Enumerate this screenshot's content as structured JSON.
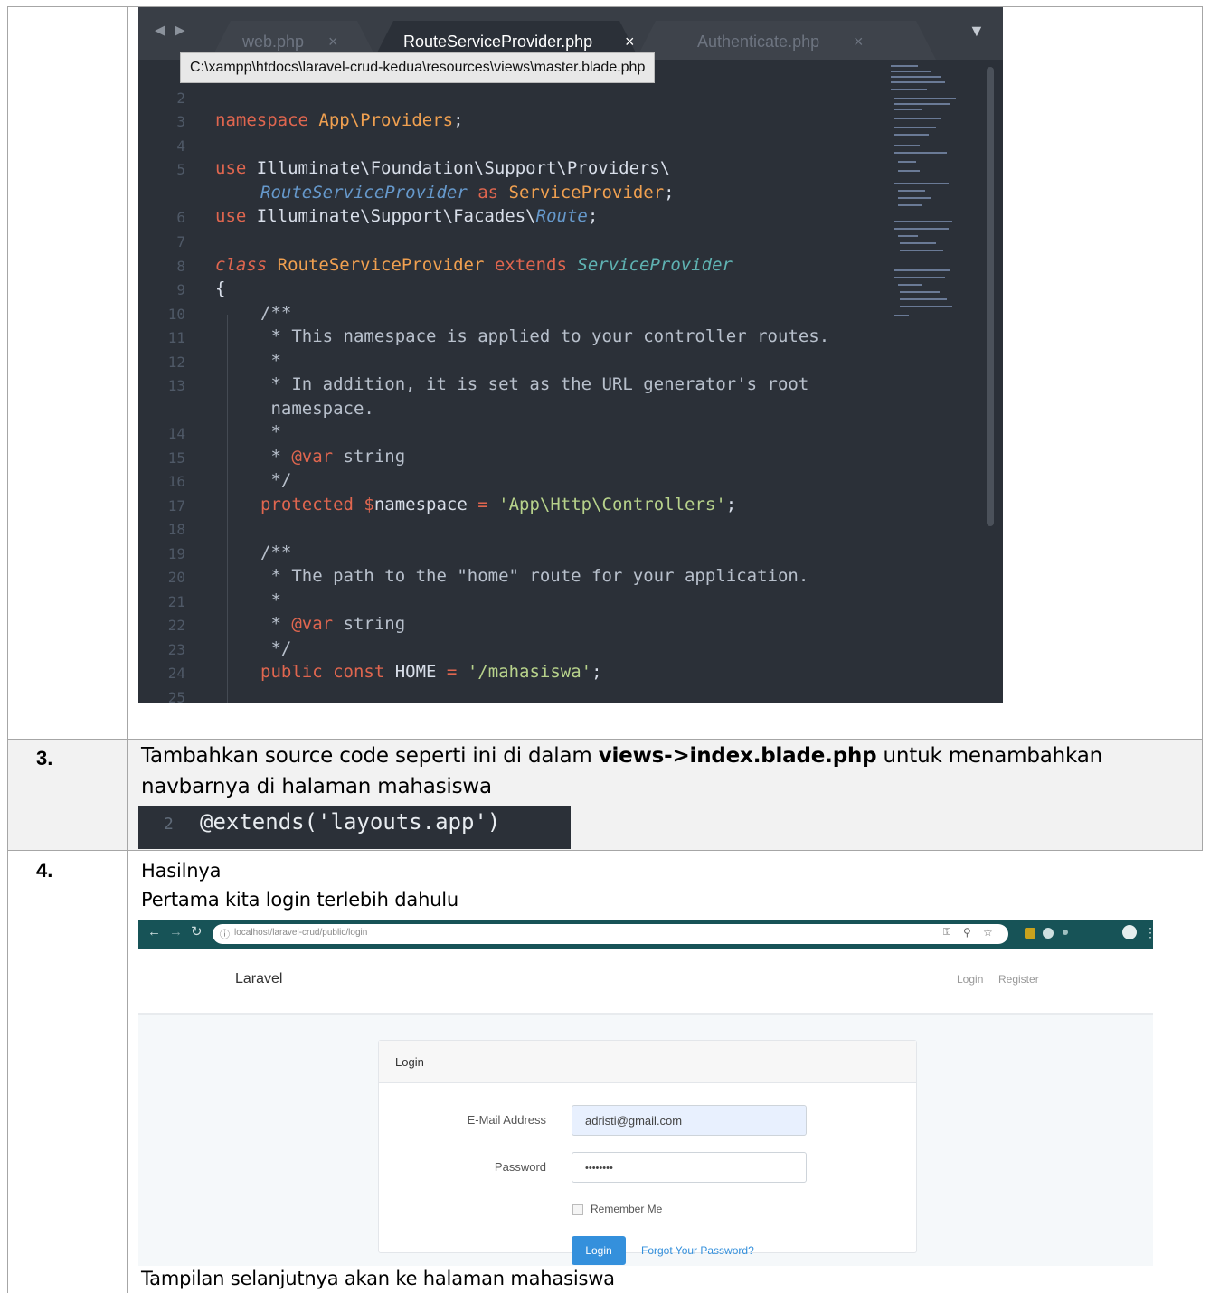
{
  "editor": {
    "tabs": [
      {
        "label": "web.php",
        "close": "×"
      },
      {
        "label": "RouteServiceProvider.php",
        "close": "×"
      },
      {
        "label": "Authenticate.php",
        "close": "×"
      }
    ],
    "tooltip": "C:\\xampp\\htdocs\\laravel-crud-kedua\\resources\\views\\master.blade.php",
    "line_numbers": [
      "2",
      "3",
      "4",
      "5",
      "6",
      "7",
      "8",
      "9",
      "10",
      "11",
      "12",
      "13",
      "14",
      "15",
      "16",
      "17",
      "18",
      "19",
      "20",
      "21",
      "22",
      "23",
      "24",
      "25"
    ],
    "code": {
      "l3_a": "namespace ",
      "l3_b": "App\\Providers",
      "l3_c": ";",
      "l5_a": "use ",
      "l5_b": "Illuminate\\Foundation\\Support\\Providers\\",
      "l5w_a": "RouteServiceProvider",
      "l5w_b": " as ",
      "l5w_c": "ServiceProvider",
      "l5w_d": ";",
      "l6_a": "use ",
      "l6_b": "Illuminate\\Support\\Facades\\",
      "l6_c": "Route",
      "l6_d": ";",
      "l8_a": "class ",
      "l8_b": "RouteServiceProvider",
      "l8_c": " extends ",
      "l8_d": "ServiceProvider",
      "l9": "{",
      "l10": "/**",
      "l11": " * This namespace is applied to your controller routes.",
      "l12": " *",
      "l13": " * In addition, it is set as the URL generator's root",
      "l13w": " namespace.",
      "l14": " *",
      "l15_a": " * ",
      "l15_b": "@var",
      "l15_c": " string",
      "l16": " */",
      "l17_a": "protected",
      "l17_b": " $",
      "l17_c": "namespace",
      "l17_d": " = ",
      "l17_e": "'App\\Http\\Controllers'",
      "l17_f": ";",
      "l19": "/**",
      "l20": " * The path to the \"home\" route for your application.",
      "l21": " *",
      "l22_a": " * ",
      "l22_b": "@var",
      "l22_c": " string",
      "l23": " */",
      "l24_a": "public",
      "l24_b": " const ",
      "l24_c": "HOME",
      "l24_d": " = ",
      "l24_e": "'/mahasiswa'",
      "l24_f": ";"
    }
  },
  "step3": {
    "number": "3.",
    "text_before": "Tambahkan source code seperti ini di dalam ",
    "text_bold": "views->index.blade.php",
    "text_after": " untuk menambahkan",
    "text_line2": "navbarnya di halaman mahasiswa",
    "snippet_line": "2",
    "snippet_code": "@extends('layouts.app')"
  },
  "step4": {
    "number": "4.",
    "line1": "Hasilnya",
    "line2": "Pertama kita login terlebih dahulu",
    "line3": "Tampilan selanjutnya akan ke halaman mahasiswa"
  },
  "browser": {
    "url": "localhost/laravel-crud/public/login",
    "brand": "Laravel",
    "nav_login": "Login",
    "nav_register": "Register",
    "card_title": "Login",
    "email_label": "E-Mail Address",
    "email_value": "adristi@gmail.com",
    "password_label": "Password",
    "password_value": "••••••••",
    "remember_label": "Remember Me",
    "login_button": "Login",
    "forgot_link": "Forgot Your Password?"
  },
  "colors": {
    "editor_bg": "#2b3038",
    "chrome_bar": "#175357",
    "primary_button": "#3490dc"
  }
}
